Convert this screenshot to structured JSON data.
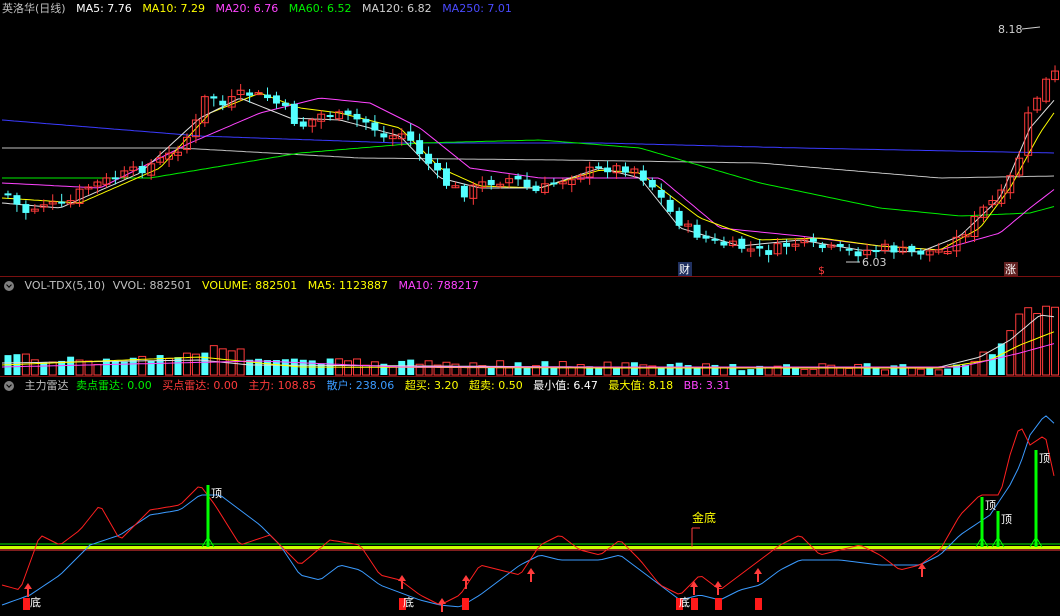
{
  "price_header": {
    "title": "英洛华(日线)",
    "ma5": "MA5: 7.76",
    "ma10": "MA10: 7.29",
    "ma20": "MA20: 6.76",
    "ma60": "MA60: 6.52",
    "ma120": "MA120: 6.82",
    "ma250": "MA250: 7.01"
  },
  "price_annotations": {
    "high": "8.18",
    "low": "6.03",
    "cai": "财",
    "s": "$",
    "zhang": "涨"
  },
  "vol_header": {
    "title": "VOL-TDX(5,10)",
    "vvol": "VVOL: 882501",
    "volume": "VOLUME: 882501",
    "ma5": "MA5: 1123887",
    "ma10": "MA10: 788217"
  },
  "ind_header": {
    "title": "主力雷达",
    "sell_radar": "卖点雷达: 0.00",
    "buy_radar": "买点雷达: 0.00",
    "zhuli": "主力: 108.85",
    "sanhu": "散户: 238.06",
    "chaomai": "超买: 3.20",
    "chaomai2": "超卖: 0.50",
    "min": "最小值: 6.47",
    "max": "最大值: 8.18",
    "bb": "BB: 3.31"
  },
  "ind_labels": {
    "ding": "顶",
    "di": "底",
    "jindi": "金底"
  },
  "colors": {
    "up": "#ff3b3b",
    "down": "#54ffff",
    "ma5": "#e0e0e0",
    "ma10": "#ffff00",
    "ma20": "#ff44ff",
    "ma60": "#00ee00",
    "ma120": "#c0c0c0",
    "ma250": "#3b3bff"
  }
}
